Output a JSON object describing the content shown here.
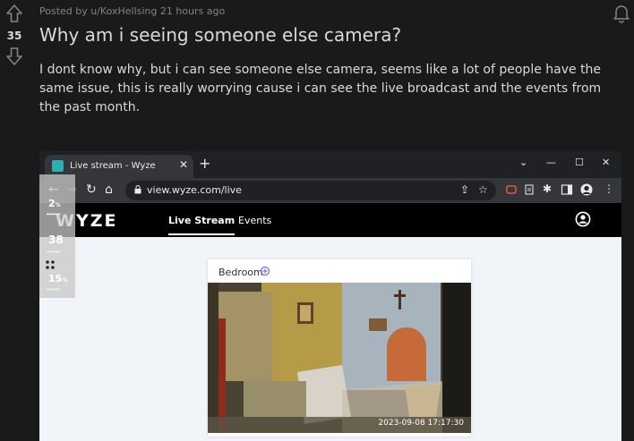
{
  "post": {
    "score": "35",
    "meta": "Posted by u/KoxHellsing 21 hours ago",
    "title": "Why am i seeing someone else camera?",
    "body": "I dont know why, but i can see someone else camera, seems like a lot of people have the same issue, this is really worrying cause i can see the live broadcast and the events from the past month."
  },
  "browser": {
    "tab_title": "Live stream - Wyze",
    "tab_close": "✕",
    "new_tab": "+",
    "url": "view.wyze.com/live",
    "win_min": "—",
    "win_max": "☐",
    "win_close": "✕",
    "win_chevron": "⌄"
  },
  "app": {
    "logo": "WYZE",
    "nav_live": "Live Stream",
    "nav_events": "Events",
    "camera_name": "Bedroom",
    "timestamp": "2023-09-08  17:17:30"
  },
  "overlay": {
    "values": [
      "2",
      "38",
      "15"
    ],
    "units": [
      "%",
      "",
      "%"
    ]
  },
  "colors": {
    "background": "#1a1a1b",
    "text": "#d7dadc",
    "muted": "#818384",
    "wyze_bar": "#000000"
  }
}
